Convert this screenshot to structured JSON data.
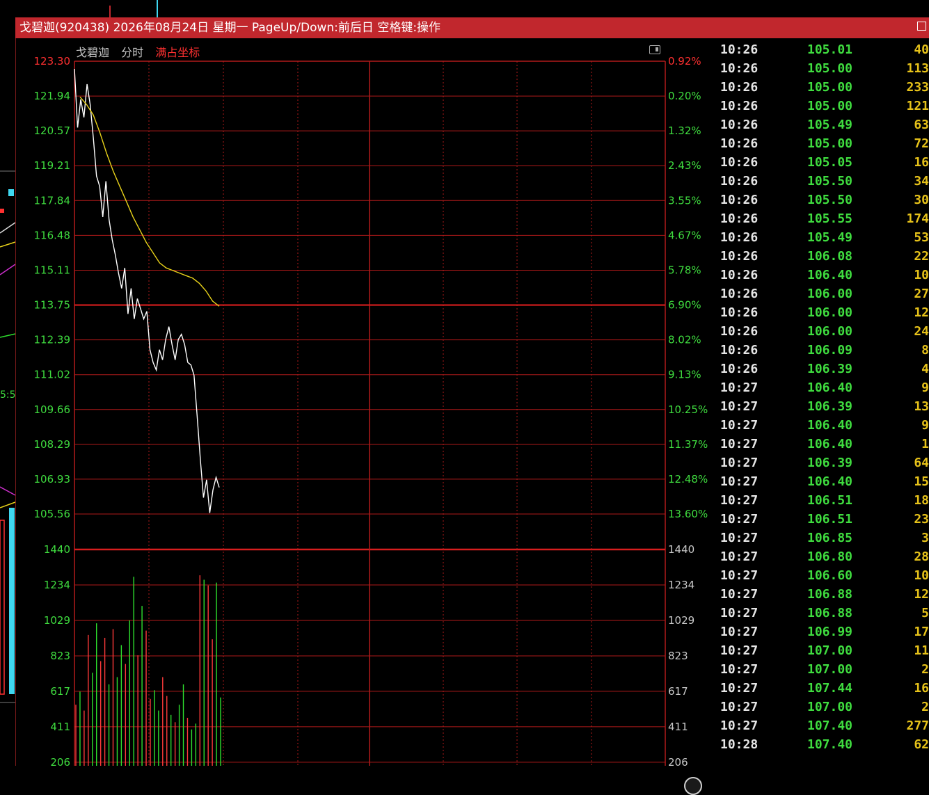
{
  "window": {
    "title": "戈碧迦(920438) 2026年08月24日 星期一 PageUp/Down:前后日 空格键:操作"
  },
  "chart_header": {
    "name": "戈碧迦",
    "mode": "分时",
    "coord": "满占坐标"
  },
  "colors": {
    "price_line": "#ffffff",
    "avg_line": "#e8d21a",
    "up_volume": "#ff3a3a",
    "down_volume": "#2ee02e",
    "grid": "#b11a1a",
    "axis_left": "#3fdc3f",
    "axis_right": "#3fdc3f",
    "title_bar": "#c1272d"
  },
  "chart_data": {
    "type": "line",
    "price_axis_left": [
      "123.30",
      "121.94",
      "120.57",
      "119.21",
      "117.84",
      "116.48",
      "115.11",
      "113.75",
      "112.39",
      "111.02",
      "109.66",
      "108.29",
      "106.93",
      "105.56"
    ],
    "price_axis_right": [
      "0.92%",
      "0.20%",
      "1.32%",
      "2.43%",
      "3.55%",
      "4.67%",
      "5.78%",
      "6.90%",
      "8.02%",
      "9.13%",
      "10.25%",
      "11.37%",
      "12.48%",
      "13.60%"
    ],
    "volume_axis": [
      "1440",
      "1234",
      "1029",
      "823",
      "617",
      "411",
      "206"
    ],
    "ylim": [
      105.56,
      123.3
    ],
    "volume_ylim": [
      206,
      1440
    ],
    "price": [
      123.0,
      120.7,
      121.8,
      121.1,
      122.4,
      121.6,
      120.3,
      118.8,
      118.4,
      117.2,
      118.6,
      117.1,
      116.3,
      115.7,
      115.0,
      114.4,
      115.2,
      113.4,
      114.4,
      113.2,
      114.0,
      113.6,
      113.2,
      113.5,
      112.0,
      111.5,
      111.2,
      112.0,
      111.6,
      112.4,
      112.9,
      112.2,
      111.6,
      112.4,
      112.6,
      112.2,
      111.5,
      111.4,
      111.0,
      109.4,
      107.7,
      106.2,
      106.9,
      105.6,
      106.5,
      107.0,
      106.6
    ],
    "avg_price": [
      121.9,
      121.6,
      121.2,
      120.5,
      119.7,
      119.0,
      118.4,
      117.8,
      117.2,
      116.7,
      116.2,
      115.8,
      115.4,
      115.2,
      115.1,
      115.0,
      114.9,
      114.8,
      114.6,
      114.3,
      113.9,
      113.7
    ],
    "volume": [
      420,
      510,
      380,
      900,
      640,
      980,
      720,
      880,
      560,
      940,
      610,
      830,
      700,
      1000,
      1300,
      760,
      1100,
      930,
      460,
      520,
      380,
      610,
      480,
      350,
      300,
      420,
      560,
      330,
      250,
      290,
      1310,
      1280,
      1240,
      870,
      1260,
      470
    ]
  },
  "trades": [
    {
      "time": "10:26",
      "price": "105.01",
      "vol": "40"
    },
    {
      "time": "10:26",
      "price": "105.00",
      "vol": "113"
    },
    {
      "time": "10:26",
      "price": "105.00",
      "vol": "233"
    },
    {
      "time": "10:26",
      "price": "105.00",
      "vol": "121"
    },
    {
      "time": "10:26",
      "price": "105.49",
      "vol": "63"
    },
    {
      "time": "10:26",
      "price": "105.00",
      "vol": "72"
    },
    {
      "time": "10:26",
      "price": "105.05",
      "vol": "16"
    },
    {
      "time": "10:26",
      "price": "105.50",
      "vol": "34"
    },
    {
      "time": "10:26",
      "price": "105.50",
      "vol": "30"
    },
    {
      "time": "10:26",
      "price": "105.55",
      "vol": "174"
    },
    {
      "time": "10:26",
      "price": "105.49",
      "vol": "53"
    },
    {
      "time": "10:26",
      "price": "106.08",
      "vol": "22"
    },
    {
      "time": "10:26",
      "price": "106.40",
      "vol": "10"
    },
    {
      "time": "10:26",
      "price": "106.00",
      "vol": "27"
    },
    {
      "time": "10:26",
      "price": "106.00",
      "vol": "12"
    },
    {
      "time": "10:26",
      "price": "106.00",
      "vol": "24"
    },
    {
      "time": "10:26",
      "price": "106.09",
      "vol": "8"
    },
    {
      "time": "10:26",
      "price": "106.39",
      "vol": "4"
    },
    {
      "time": "10:27",
      "price": "106.40",
      "vol": "9"
    },
    {
      "time": "10:27",
      "price": "106.39",
      "vol": "13"
    },
    {
      "time": "10:27",
      "price": "106.40",
      "vol": "9"
    },
    {
      "time": "10:27",
      "price": "106.40",
      "vol": "1"
    },
    {
      "time": "10:27",
      "price": "106.39",
      "vol": "64"
    },
    {
      "time": "10:27",
      "price": "106.40",
      "vol": "15"
    },
    {
      "time": "10:27",
      "price": "106.51",
      "vol": "18"
    },
    {
      "time": "10:27",
      "price": "106.51",
      "vol": "23"
    },
    {
      "time": "10:27",
      "price": "106.85",
      "vol": "3"
    },
    {
      "time": "10:27",
      "price": "106.80",
      "vol": "28"
    },
    {
      "time": "10:27",
      "price": "106.60",
      "vol": "10"
    },
    {
      "time": "10:27",
      "price": "106.88",
      "vol": "12"
    },
    {
      "time": "10:27",
      "price": "106.88",
      "vol": "5"
    },
    {
      "time": "10:27",
      "price": "106.99",
      "vol": "17"
    },
    {
      "time": "10:27",
      "price": "107.00",
      "vol": "11"
    },
    {
      "time": "10:27",
      "price": "107.00",
      "vol": "2"
    },
    {
      "time": "10:27",
      "price": "107.44",
      "vol": "16"
    },
    {
      "time": "10:27",
      "price": "107.00",
      "vol": "2"
    },
    {
      "time": "10:27",
      "price": "107.40",
      "vol": "277"
    },
    {
      "time": "10:28",
      "price": "107.40",
      "vol": "62"
    }
  ]
}
